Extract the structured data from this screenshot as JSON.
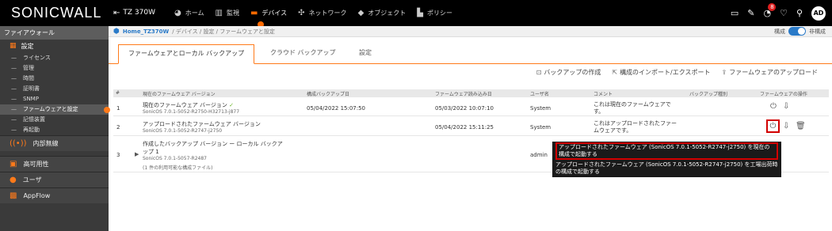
{
  "app": {
    "logo": "SONICWALL",
    "device": "TZ 370W"
  },
  "topnav": [
    {
      "icon": "home-icon",
      "glyph": "◕",
      "label": "ホーム"
    },
    {
      "icon": "monitor-icon",
      "glyph": "▥",
      "label": "監視"
    },
    {
      "icon": "device-icon",
      "glyph": "▬",
      "label": "デバイス"
    },
    {
      "icon": "network-icon",
      "glyph": "✣",
      "label": "ネットワーク"
    },
    {
      "icon": "object-icon",
      "glyph": "◆",
      "label": "オブジェクト"
    },
    {
      "icon": "policy-icon",
      "glyph": "▙",
      "label": "ポリシー"
    }
  ],
  "top_right": {
    "notification_count": "8",
    "avatar": "AD"
  },
  "sidebar": {
    "section": "ファイアウォール",
    "group": "設定",
    "items": [
      "ライセンス",
      "管理",
      "時間",
      "証明書",
      "SNMP",
      "ファームウェアと設定",
      "記憶装置",
      "再起動"
    ],
    "blocks": [
      {
        "icon": "internal-wireless-icon",
        "label": "内部無線"
      },
      {
        "icon": "high-availability-icon",
        "label": "高可用性"
      },
      {
        "icon": "user-icon",
        "label": "ユーザ"
      },
      {
        "icon": "appflow-icon",
        "label": "AppFlow"
      }
    ]
  },
  "breadcrumb": {
    "root": "Home_TZ370W",
    "rest": "/ デバイス / 設定 / ファームウェアと設定",
    "mode_left": "構成",
    "mode_right": "非構成"
  },
  "tabs": [
    "ファームウェアとローカル バックアップ",
    "クラウド バックアップ",
    "設定"
  ],
  "toolbar": [
    "バックアップの作成",
    "構成のインポート/エクスポート",
    "ファームウェアのアップロード"
  ],
  "table": {
    "headers": [
      "#",
      "現在のファームウェア バージョン",
      "構成バックアップ日",
      "ファームウェア読み込み日",
      "ユーザ名",
      "コメント",
      "バックアップ種別",
      "ファームウェアの操作"
    ],
    "rows": [
      {
        "num": "1",
        "title": "現在のファームウェア バージョン",
        "version": "SonicOS 7.0.1-5052-R2750-H32713-j877",
        "backup_date": "05/04/2022 15:07:50",
        "load_date": "05/03/2022 10:07:10",
        "user": "System",
        "comment1": "これは現在のファームウェアで",
        "comment2": "す。"
      },
      {
        "num": "2",
        "title": "アップロードされたファームウェア バージョン",
        "version": "SonicOS 7.0.1-5052-R2747-j2750",
        "backup_date": "",
        "load_date": "05/04/2022 15:11:25",
        "user": "System",
        "comment1": "これはアップロードされたファー",
        "comment2": "ムウェアです。"
      },
      {
        "num": "3",
        "title1": "作成したバックアップ バージョン ー ローカル バックア",
        "title2": "ップ 1",
        "version": "SonicOS 7.0.1-5057-R2487",
        "note": "(1 件の利用可能な構成ファイル)",
        "user": "admin"
      }
    ]
  },
  "tooltip": {
    "line1": "アップロードされたファームウェア (SonicOS 7.0.1-5052-R2747-j2750) を現在の構成で起動する",
    "line2": "アップロードされたファームウェア (SonicOS 7.0.1-5052-R2747-j2750) を工場出荷時の構成で起動する"
  }
}
